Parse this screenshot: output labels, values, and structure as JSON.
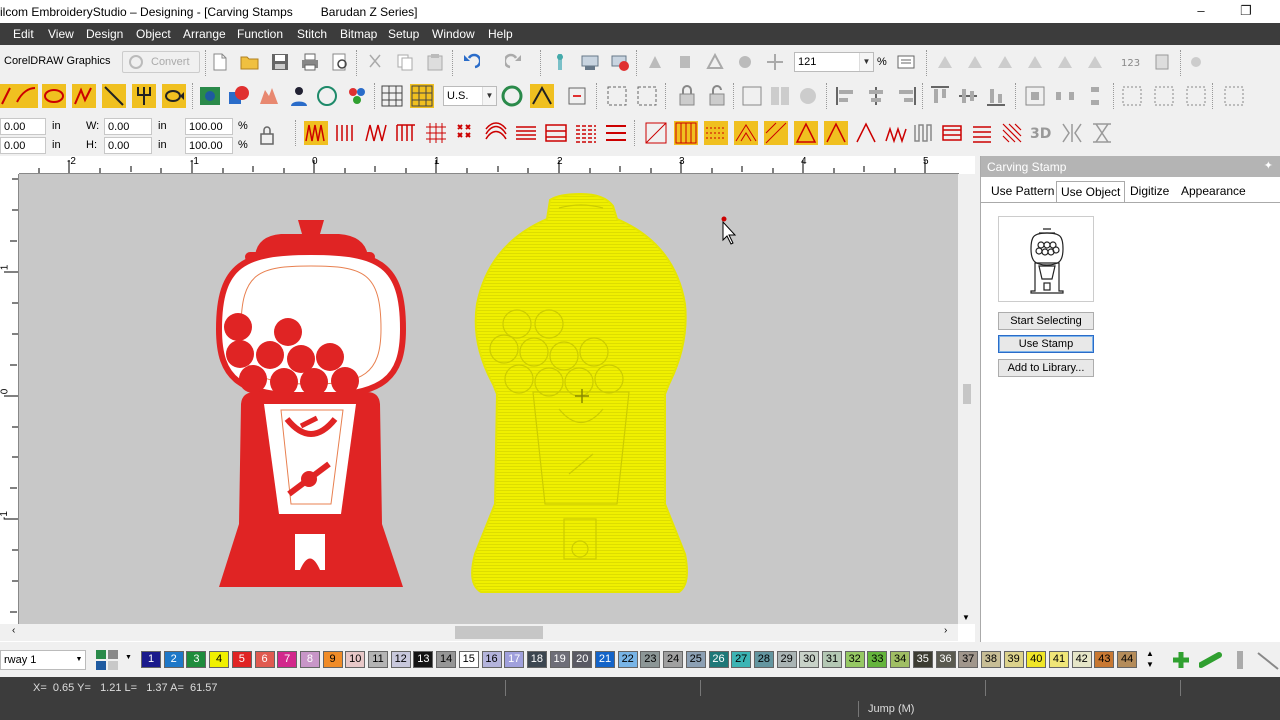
{
  "window": {
    "title": "ilcom EmbroideryStudio – Designing - [Carving Stamps",
    "title_extra": "Barudan Z Series]",
    "minimize": "–",
    "restore": "❐"
  },
  "menu": [
    "Edit",
    "View",
    "Design",
    "Object",
    "Arrange",
    "Function",
    "Stitch",
    "Bitmap",
    "Setup",
    "Window",
    "Help"
  ],
  "toolbar1": {
    "coreldraw_label": "CorelDRAW Graphics",
    "convert_label": "Convert",
    "zoom_value": "121",
    "zoom_unit": "%"
  },
  "toolbar2": {
    "units_value": "U.S."
  },
  "toolbar3": {
    "x_value": "0.00",
    "y_value": "0.00",
    "x_unit": "in",
    "y_unit": "in",
    "w_label": "W:",
    "h_label": "H:",
    "w_value": "0.00",
    "h_value": "0.00",
    "w_unit": "in",
    "h_unit": "in",
    "w_pct": "100.00",
    "h_pct": "100.00",
    "pct_sign": "%",
    "three_d": "3D"
  },
  "ruler": {
    "h_labels": [
      "-2",
      "-1",
      "0",
      "1",
      "2",
      "3",
      "4",
      "5"
    ],
    "v_labels": [
      "1",
      "0",
      "-1"
    ]
  },
  "panel": {
    "title": "Carving Stamp",
    "pin": "✦",
    "tabs": [
      "Use Pattern",
      "Use Object",
      "Digitize",
      "Appearance"
    ],
    "active_tab": "Use Object",
    "buttons": {
      "start_selecting": "Start Selecting",
      "use_stamp": "Use Stamp",
      "add_to_library": "Add to Library..."
    }
  },
  "colors": {
    "red_design": "#e02424",
    "yellow_design": "#f0f000",
    "canvas_bg": "#c8c8c8",
    "dark_bar": "#3c3c3c"
  },
  "palette": {
    "layer_value": "rway 1",
    "swatches": [
      {
        "n": "1",
        "c": "#1a1a8c",
        "t": "#fff"
      },
      {
        "n": "2",
        "c": "#1e78c8",
        "t": "#fff"
      },
      {
        "n": "3",
        "c": "#1e8c3c",
        "t": "#fff"
      },
      {
        "n": "4",
        "c": "#f0f000",
        "t": "#000"
      },
      {
        "n": "5",
        "c": "#e02424",
        "t": "#fff"
      },
      {
        "n": "6",
        "c": "#e05a50",
        "t": "#fff"
      },
      {
        "n": "7",
        "c": "#d2288c",
        "t": "#fff"
      },
      {
        "n": "8",
        "c": "#c896c8",
        "t": "#fff"
      },
      {
        "n": "9",
        "c": "#f08c28",
        "t": "#000"
      },
      {
        "n": "10",
        "c": "#e8c8c8",
        "t": "#000"
      },
      {
        "n": "11",
        "c": "#b4b4b4",
        "t": "#000"
      },
      {
        "n": "12",
        "c": "#c8c8dc",
        "t": "#000"
      },
      {
        "n": "13",
        "c": "#141414",
        "t": "#fff"
      },
      {
        "n": "14",
        "c": "#969696",
        "t": "#000"
      },
      {
        "n": "15",
        "c": "#ffffff",
        "t": "#000"
      },
      {
        "n": "16",
        "c": "#b4b4dc",
        "t": "#000"
      },
      {
        "n": "17",
        "c": "#a0a0dc",
        "t": "#fff"
      },
      {
        "n": "18",
        "c": "#3c4650",
        "t": "#fff"
      },
      {
        "n": "19",
        "c": "#6e6e78",
        "t": "#fff"
      },
      {
        "n": "20",
        "c": "#5a5a64",
        "t": "#fff"
      },
      {
        "n": "21",
        "c": "#1464c8",
        "t": "#fff"
      },
      {
        "n": "22",
        "c": "#78b4e6",
        "t": "#000"
      },
      {
        "n": "23",
        "c": "#8c9696",
        "t": "#000"
      },
      {
        "n": "24",
        "c": "#a0a0a0",
        "t": "#000"
      },
      {
        "n": "25",
        "c": "#8ca0b4",
        "t": "#000"
      },
      {
        "n": "26",
        "c": "#1e7878",
        "t": "#fff"
      },
      {
        "n": "27",
        "c": "#3cb4b4",
        "t": "#000"
      },
      {
        "n": "28",
        "c": "#6496a0",
        "t": "#000"
      },
      {
        "n": "29",
        "c": "#aab4b4",
        "t": "#000"
      },
      {
        "n": "30",
        "c": "#c8d2c8",
        "t": "#000"
      },
      {
        "n": "31",
        "c": "#b4c8b4",
        "t": "#000"
      },
      {
        "n": "32",
        "c": "#96c864",
        "t": "#000"
      },
      {
        "n": "33",
        "c": "#64b43c",
        "t": "#000"
      },
      {
        "n": "34",
        "c": "#a0be64",
        "t": "#000"
      },
      {
        "n": "35",
        "c": "#3c3c32",
        "t": "#fff"
      },
      {
        "n": "36",
        "c": "#5a5a50",
        "t": "#fff"
      },
      {
        "n": "37",
        "c": "#a0968c",
        "t": "#000"
      },
      {
        "n": "38",
        "c": "#c8be96",
        "t": "#000"
      },
      {
        "n": "39",
        "c": "#dcd28c",
        "t": "#000"
      },
      {
        "n": "40",
        "c": "#f0e628",
        "t": "#000"
      },
      {
        "n": "41",
        "c": "#f0e678",
        "t": "#000"
      },
      {
        "n": "42",
        "c": "#e6e6c8",
        "t": "#000"
      },
      {
        "n": "43",
        "c": "#c87832",
        "t": "#000"
      },
      {
        "n": "44",
        "c": "#b48c5a",
        "t": "#000"
      }
    ]
  },
  "status": {
    "coords": "X=  0.65 Y=   1.21 L=   1.37 A=  61.57",
    "hint": "Jump (M)"
  }
}
